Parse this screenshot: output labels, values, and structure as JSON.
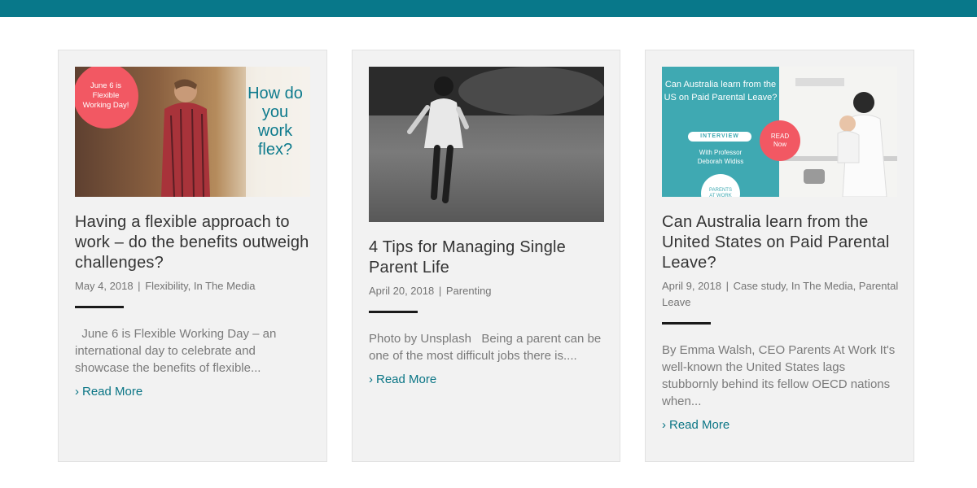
{
  "colors": {
    "topbar": "#08788a",
    "accent": "#0a7585",
    "badge": "#f25863"
  },
  "posts": [
    {
      "title": "Having a flexible approach to work – do the benefits outweigh challenges?",
      "date": "May 4, 2018",
      "categories": "Flexibility, In The Media",
      "excerpt": "  June 6 is Flexible Working Day – an international day to celebrate and showcase the benefits of flexible...",
      "read_more": "Read More",
      "image": {
        "badge": "June 6 is Flexible Working Day!",
        "headline": "How do you work flex?"
      }
    },
    {
      "title": "4 Tips for Managing Single Parent Life",
      "date": "April 20, 2018",
      "categories": "Parenting",
      "excerpt": "Photo by Unsplash   Being a parent can be one of the most difficult jobs there is....",
      "read_more": "Read More"
    },
    {
      "title": "Can Australia learn from the United States on Paid Parental Leave?",
      "date": "April 9, 2018",
      "categories": "Case study, In The Media, Parental Leave",
      "excerpt": "By Emma Walsh, CEO Parents At Work It's well-known the United States lags stubbornly behind its fellow OECD nations when...",
      "read_more": "Read More",
      "image": {
        "question": "Can Australia learn from the US on Paid Parental Leave?",
        "pill": "INTERVIEW",
        "with": "With Professor Deborah Widiss",
        "read_now": "READ Now",
        "logo": "PARENTS AT WORK"
      }
    }
  ],
  "separator": "|",
  "chevron": "›"
}
